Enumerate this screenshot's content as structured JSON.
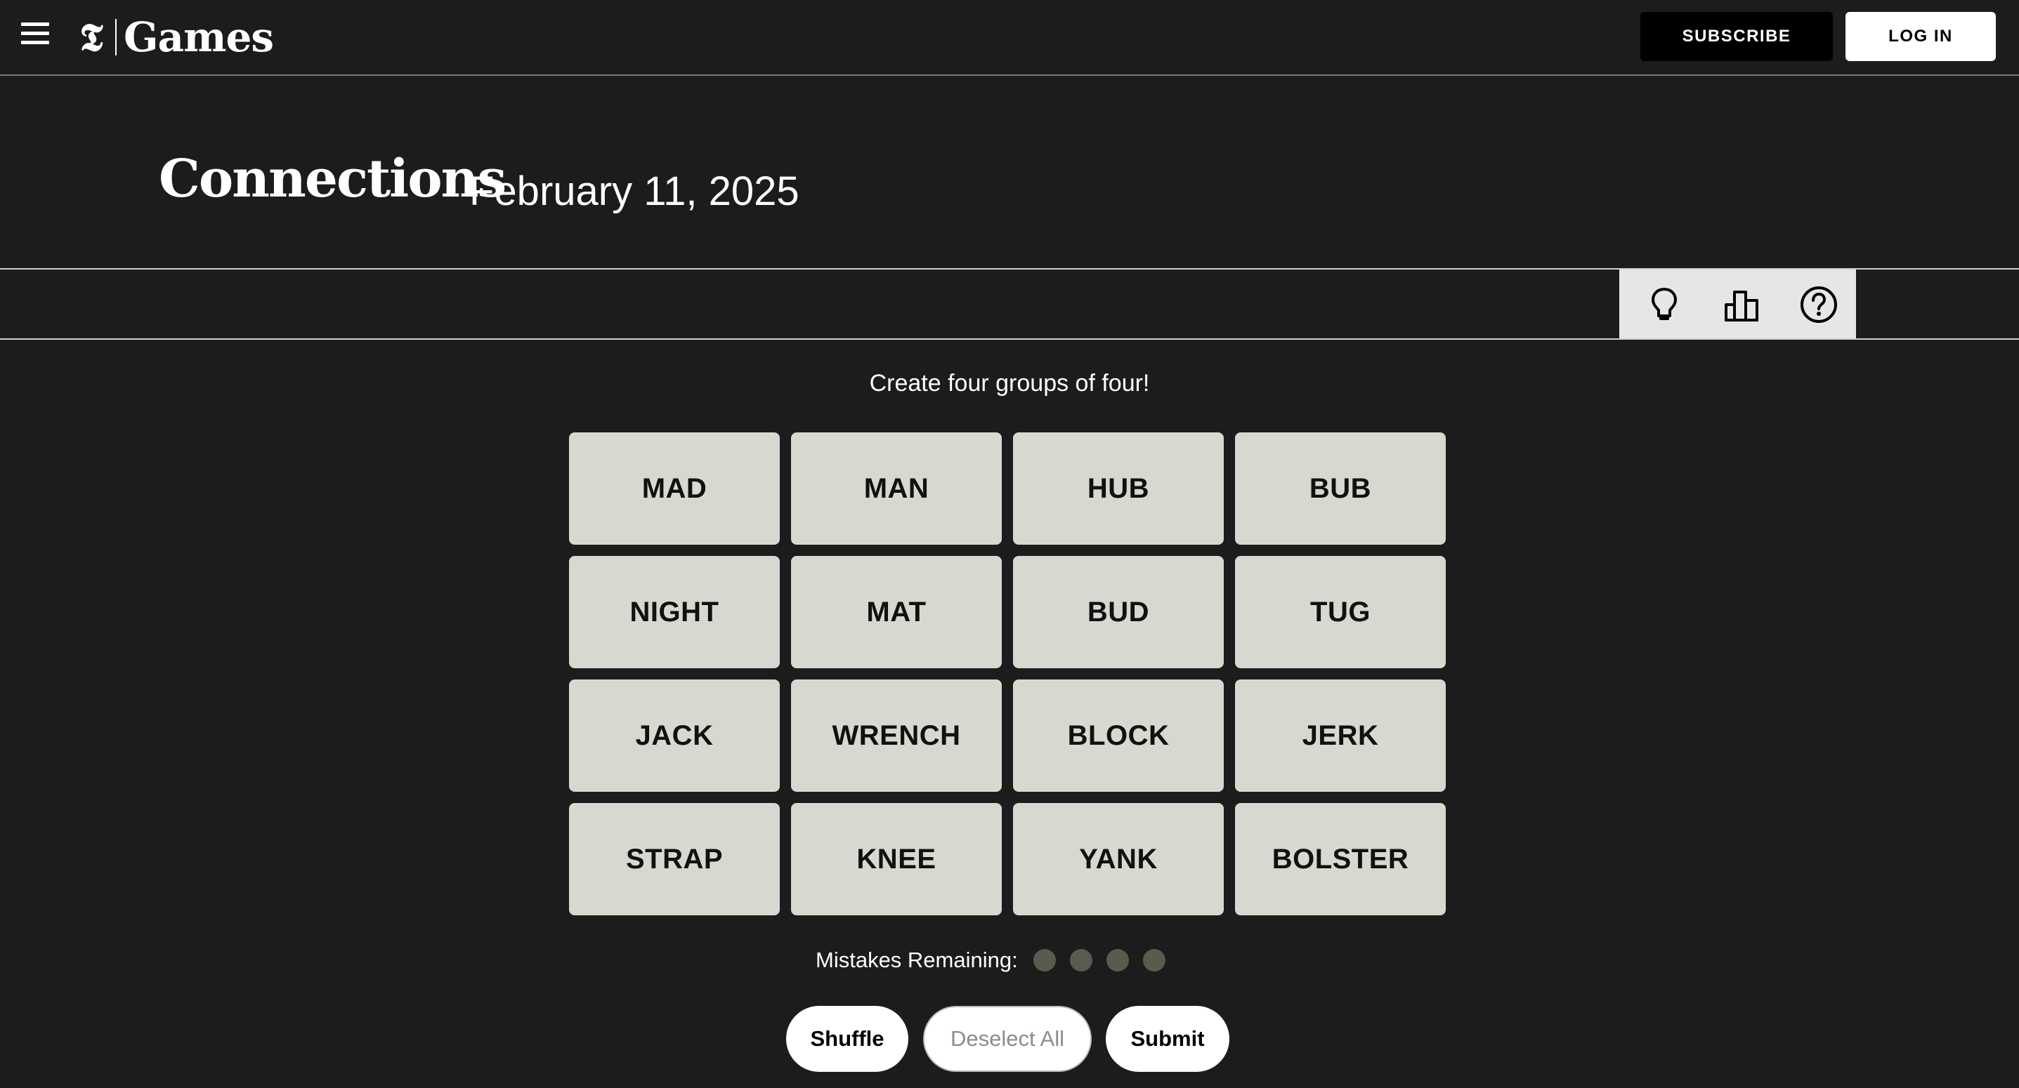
{
  "header": {
    "menu_icon": "hamburger-menu-icon",
    "logo_mark": "𝕿",
    "brand_name": "Games",
    "subscribe_label": "SUBSCRIBE",
    "login_label": "LOG IN"
  },
  "title": {
    "game_name": "Connections",
    "date": "February 11, 2025"
  },
  "toolbar": {
    "icons": [
      "lightbulb-hint-icon",
      "leaderboard-stats-icon",
      "help-question-icon"
    ]
  },
  "game": {
    "instructions": "Create four groups of four!",
    "tiles": [
      "MAD",
      "MAN",
      "HUB",
      "BUB",
      "NIGHT",
      "MAT",
      "BUD",
      "TUG",
      "JACK",
      "WRENCH",
      "BLOCK",
      "JERK",
      "STRAP",
      "KNEE",
      "YANK",
      "BOLSTER"
    ],
    "mistakes_label": "Mistakes Remaining:",
    "mistakes_remaining": 4,
    "buttons": {
      "shuffle": "Shuffle",
      "deselect_all": "Deselect All",
      "submit": "Submit"
    }
  },
  "colors": {
    "background": "#1c1c1c",
    "tile": "#d9d8d0",
    "mistake_dot": "#5a5a4f"
  }
}
